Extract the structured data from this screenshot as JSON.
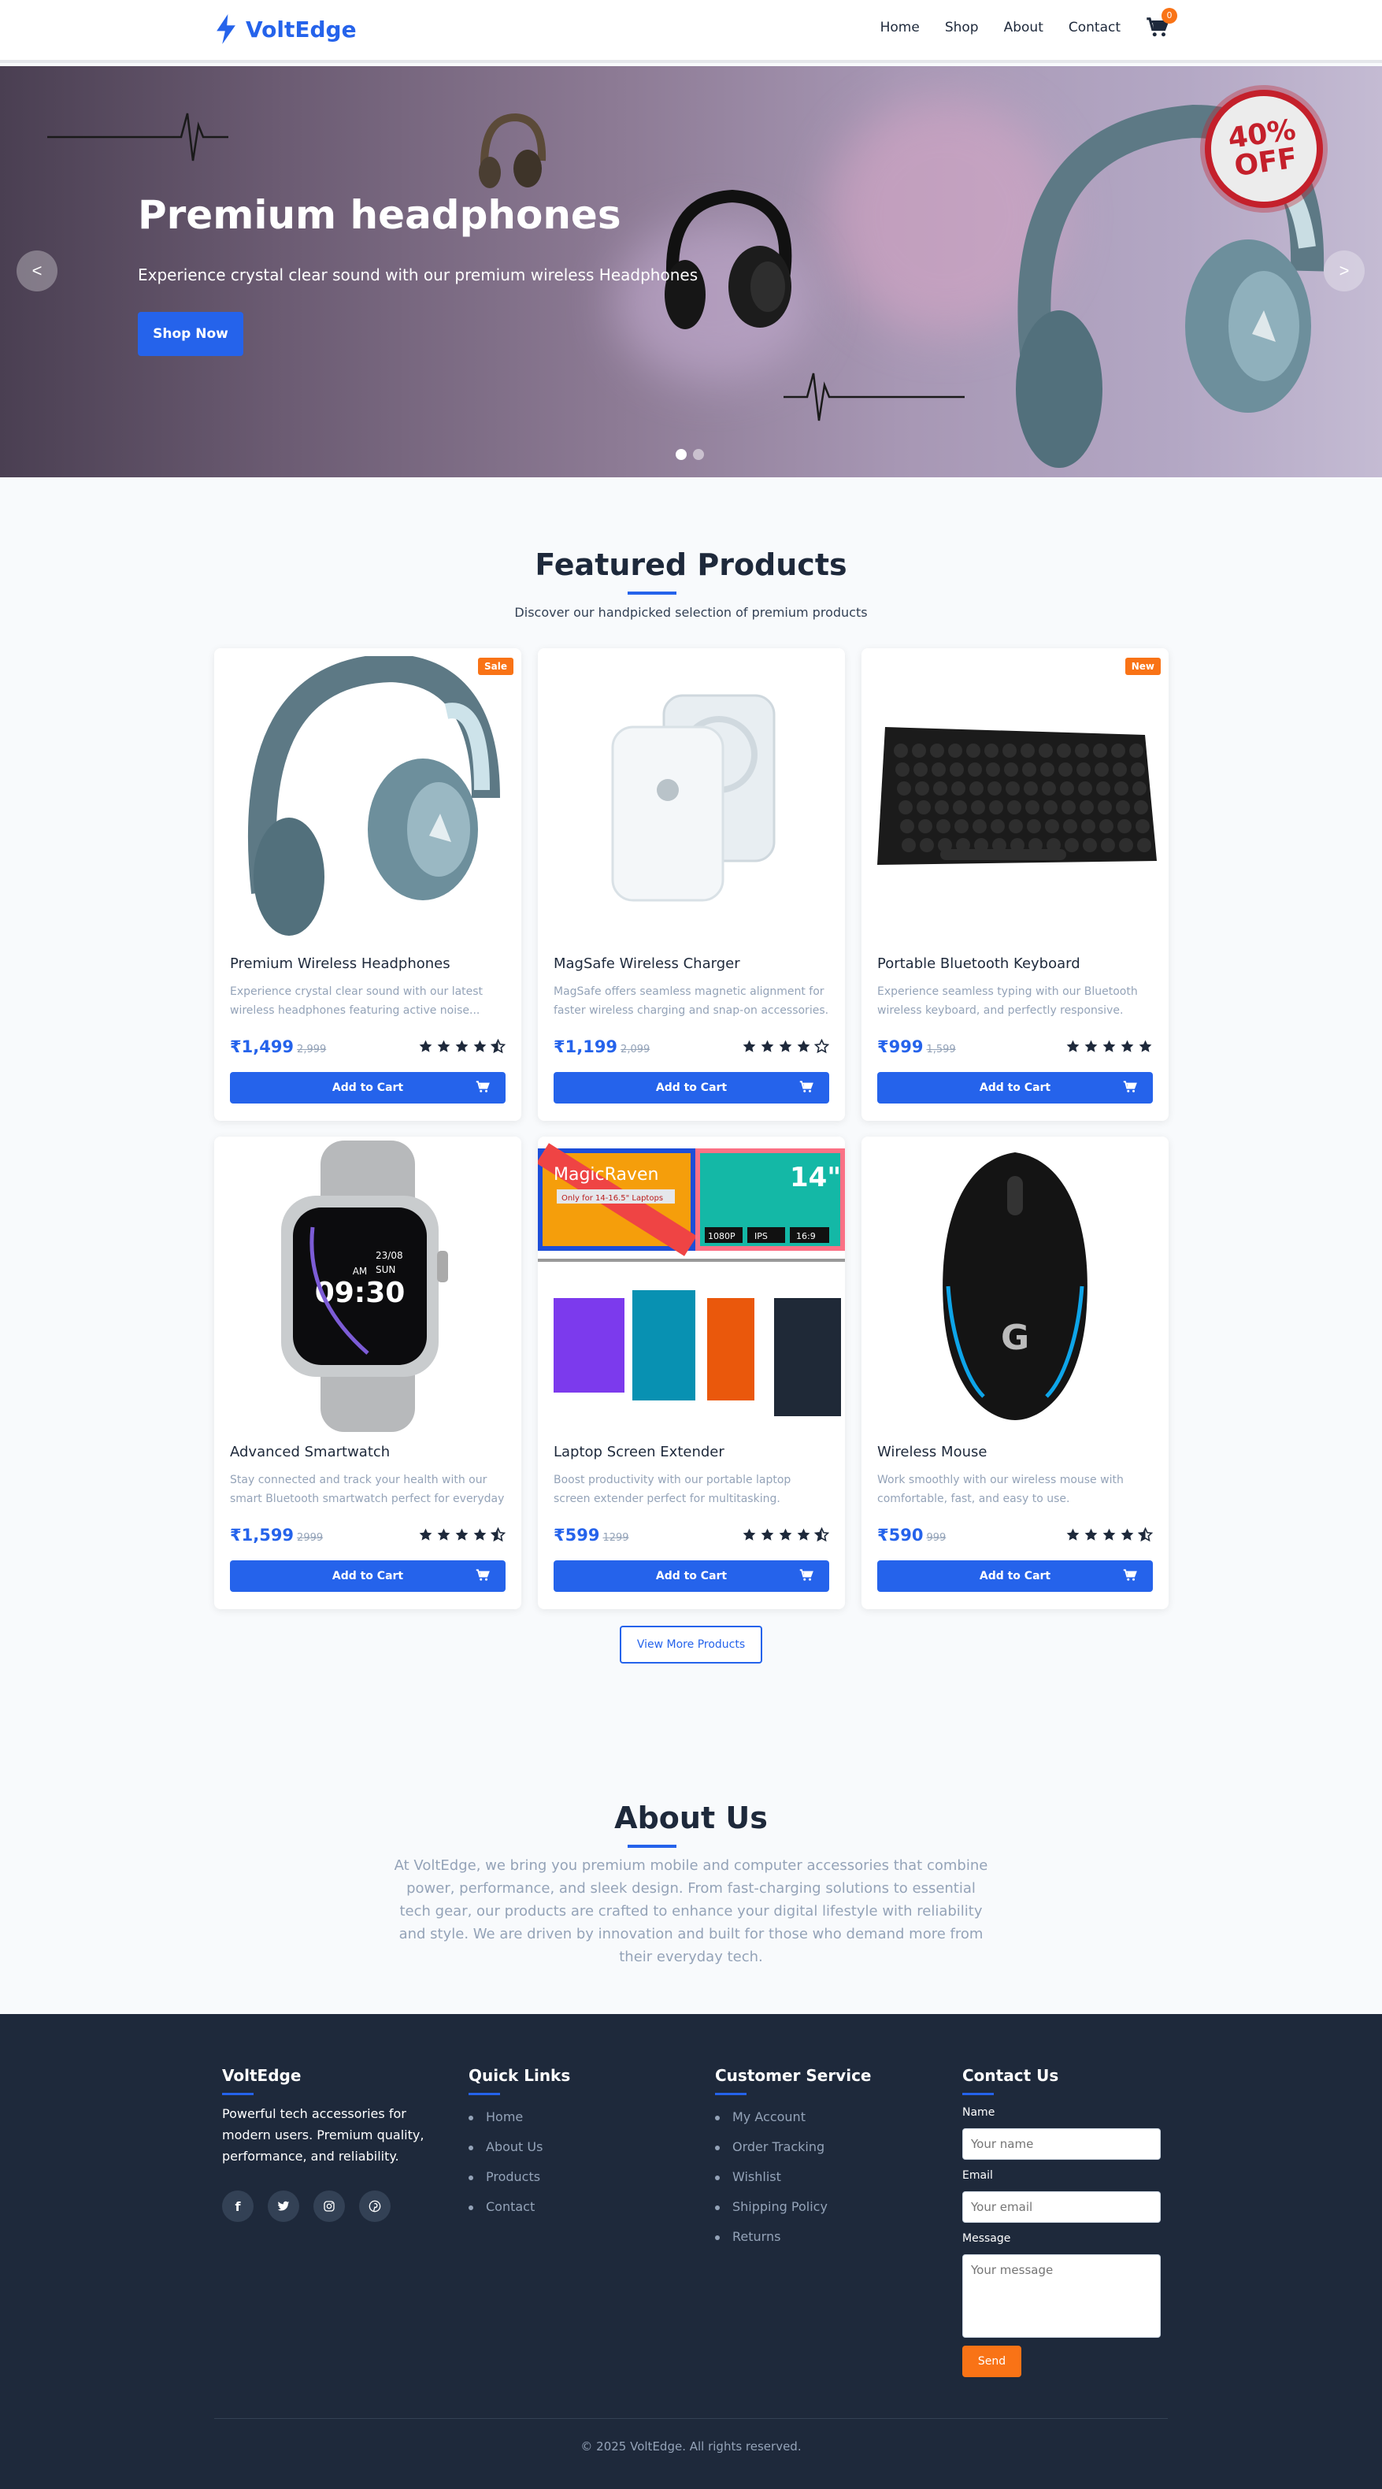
{
  "brand": {
    "name": "VoltEdge"
  },
  "nav": {
    "items": [
      "Home",
      "Shop",
      "About",
      "Contact"
    ],
    "cart_count": "0"
  },
  "hero": {
    "title": "Premium headphones",
    "subtitle": "Experience crystal clear sound with our premium wireless Headphones",
    "cta": "Shop Now",
    "prev": "<",
    "next": ">",
    "promo_line1": "40%",
    "promo_line2": "OFF",
    "slides": 2,
    "active_slide": 0
  },
  "featured": {
    "title": "Featured Products",
    "subtitle": "Discover our handpicked selection of premium products",
    "add_label": "Add to Cart",
    "view_more": "View More Products",
    "products": [
      {
        "name": "Premium Wireless Headphones",
        "desc": "Experience crystal clear sound with our latest wireless headphones featuring active noise...",
        "price": "₹1,499",
        "old": "2,999",
        "rating": 4.5,
        "tag": "Sale",
        "image": "headphones"
      },
      {
        "name": "MagSafe Wireless Charger",
        "desc": "MagSafe offers seamless magnetic alignment for faster wireless charging and snap-on accessories.",
        "price": "₹1,199",
        "old": "2,099",
        "rating": 4,
        "tag": "",
        "image": "magsafe"
      },
      {
        "name": "Portable Bluetooth Keyboard",
        "desc": "Experience seamless typing with our Bluetooth wireless keyboard, and perfectly responsive.",
        "price": "₹999",
        "old": "1,599",
        "rating": 5,
        "tag": "New",
        "image": "keyboard"
      },
      {
        "name": "Advanced Smartwatch",
        "desc": "Stay connected and track your health with our smart Bluetooth smartwatch perfect for everyday use.",
        "price": "₹1,599",
        "old": "2999",
        "rating": 4.5,
        "tag": "",
        "image": "smartwatch"
      },
      {
        "name": "Laptop Screen Extender",
        "desc": "Boost productivity with our portable laptop screen extender perfect for multitasking.",
        "price": "₹599",
        "old": "1299",
        "rating": 4.5,
        "tag": "",
        "image": "extender"
      },
      {
        "name": "Wireless Mouse",
        "desc": "Work smoothly with our wireless mouse with comfortable, fast, and easy to use.",
        "price": "₹590",
        "old": "999",
        "rating": 4.5,
        "tag": "",
        "image": "mouse"
      }
    ],
    "watch_text": {
      "am": "AM",
      "date": "23/08",
      "day": "SUN",
      "time": "09:30"
    },
    "extender_text": {
      "brand": "MagicRaven",
      "size": "14\"",
      "tagline": "Only for 14-16.5\" Laptops",
      "res": "1080P",
      "panel": "IPS",
      "ratio": "16:9"
    }
  },
  "about": {
    "title": "About Us",
    "text": "At VoltEdge, we bring you premium mobile and computer accessories that combine power, performance, and sleek design. From fast-charging solutions to essential tech gear, our products are crafted to enhance your digital lifestyle with reliability and style. We are driven by innovation and built for those who demand more from their everyday tech."
  },
  "footer": {
    "brand_title": "VoltEdge",
    "brand_text": "Powerful tech accessories for modern users. Premium quality, performance, and reliability.",
    "socials": [
      "facebook-icon",
      "twitter-icon",
      "instagram-icon",
      "pinterest-icon"
    ],
    "quick_title": "Quick Links",
    "quick_links": [
      "Home",
      "About Us",
      "Products",
      "Contact"
    ],
    "service_title": "Customer Service",
    "service_links": [
      "My Account",
      "Order Tracking",
      "Wishlist",
      "Shipping Policy",
      "Returns"
    ],
    "contact_title": "Contact Us",
    "name_label": "Name",
    "name_placeholder": "Your name",
    "email_label": "Email",
    "email_placeholder": "Your email",
    "message_label": "Message",
    "message_placeholder": "Your message",
    "send": "Send",
    "copyright": "© 2025 VoltEdge. All rights reserved."
  },
  "colors": {
    "accent": "#2563eb",
    "orange": "#f97316",
    "footer_bg": "#1e293b",
    "star": "#1e293b"
  }
}
